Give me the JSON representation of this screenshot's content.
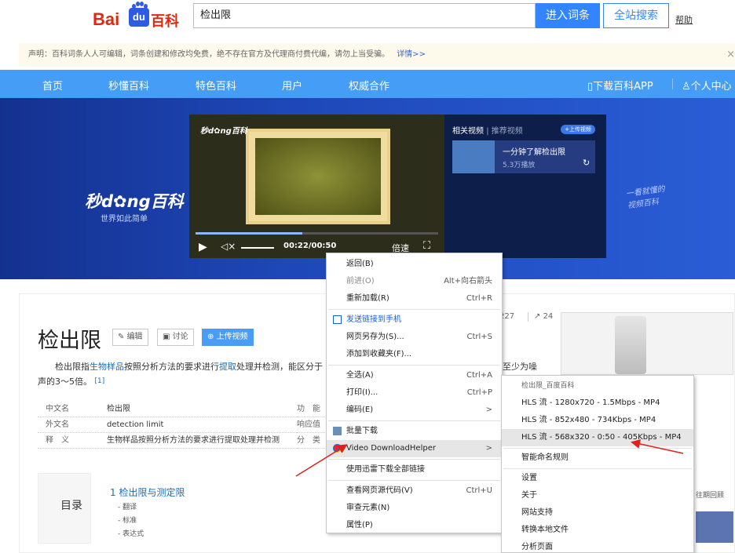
{
  "header": {
    "logo_bai": "Bai",
    "logo_du": "du",
    "logo_baike": "百科",
    "search_value": "检出限",
    "btn_enter": "进入词条",
    "btn_all": "全站搜索",
    "help": "帮助"
  },
  "notice": {
    "text": "声明：百科词条人人可编辑，词条创建和修改均免费，绝不存在官方及代理商付费代编，请勿上当受骗。",
    "more": "详情>>",
    "close": "×"
  },
  "nav": {
    "items": [
      "首页",
      "秒懂百科",
      "特色百科",
      "用户",
      "权威合作"
    ],
    "download_app": "下载百科APP",
    "personal": "个人中心"
  },
  "banner": {
    "brand": "秒d✿ng百科",
    "slogan": "世界如此简单",
    "right_deco_1": "一看就懂的",
    "right_deco_2": "视频百科",
    "player": {
      "watermark": "秒d✿ng百科",
      "time": "00:22/00:50",
      "speed": "倍速",
      "progress": 0.44
    },
    "side": {
      "tab_related": "相关视频",
      "tab_recommend": "推荐视频",
      "upload": "+上传视频",
      "card_title": "一分钟了解检出限",
      "card_plays": "5.3万播放"
    }
  },
  "article": {
    "title": "检出限",
    "btn_edit": "编辑",
    "btn_discuss": "讨论",
    "btn_upload_video": "上传视频",
    "summary_pre": "检出限指",
    "summary_link1": "生物样品",
    "summary_mid1": "按照分析方法的要求进行",
    "summary_link2": "提取",
    "summary_mid2": "处理并检测，能区分于",
    "summary_tail": "至少为噪",
    "summary_line2": "声的3～5倍。",
    "summary_ref": "[1]",
    "stat_likes": "227",
    "stat_shares": "24",
    "basic_info": [
      {
        "k": "中文名",
        "v": "检出限"
      },
      {
        "k": "外文名",
        "v": "detection limit"
      },
      {
        "k": "释　义",
        "v": "生物样品按照分析方法的要求进行提取处理并检测"
      }
    ],
    "basic_info_right": [
      "功　能",
      "响应值",
      "分　类"
    ],
    "toc_label": "目录",
    "toc_main": "1  检出限与测定限",
    "toc_subs": [
      "翻译",
      "标准",
      "表达式"
    ],
    "right_bottom_text": "往期回顾"
  },
  "context_menu": {
    "items": [
      {
        "label": "返回(B)",
        "shortcut": ""
      },
      {
        "label": "前进(O)",
        "shortcut": "Alt+向右箭头"
      },
      {
        "label": "重新加载(R)",
        "shortcut": "Ctrl+R"
      },
      {
        "label": "发送链接到手机",
        "shortcut": ""
      },
      {
        "label": "网页另存为(S)...",
        "shortcut": "Ctrl+S"
      },
      {
        "label": "添加到收藏夹(F)...",
        "shortcut": ""
      },
      {
        "label": "全选(A)",
        "shortcut": "Ctrl+A"
      },
      {
        "label": "打印(I)...",
        "shortcut": "Ctrl+P"
      },
      {
        "label": "编码(E)",
        "shortcut": ">"
      },
      {
        "label": "批量下载",
        "shortcut": ""
      },
      {
        "label": "Video DownloadHelper",
        "shortcut": ">"
      },
      {
        "label": "使用迅雷下载全部链接",
        "shortcut": ""
      },
      {
        "label": "查看网页源代码(V)",
        "shortcut": "Ctrl+U"
      },
      {
        "label": "审查元素(N)",
        "shortcut": ""
      },
      {
        "label": "属性(P)",
        "shortcut": ""
      }
    ]
  },
  "submenu": {
    "header": "检出限_百度百科",
    "items": [
      "HLS 流 - 1280x720 - 1.5Mbps - MP4",
      "HLS 流 - 852x480 - 734Kbps - MP4",
      "HLS 流 - 568x320 - 0:50 - 405Kbps - MP4",
      "智能命名规则",
      "设置",
      "关于",
      "网站支持",
      "转换本地文件",
      "分析页面"
    ]
  },
  "colors": {
    "nav_bg": "#459df5",
    "accent_blue": "#3385ff",
    "brand_red": "#de2910",
    "arrow_red": "#e0201c"
  }
}
